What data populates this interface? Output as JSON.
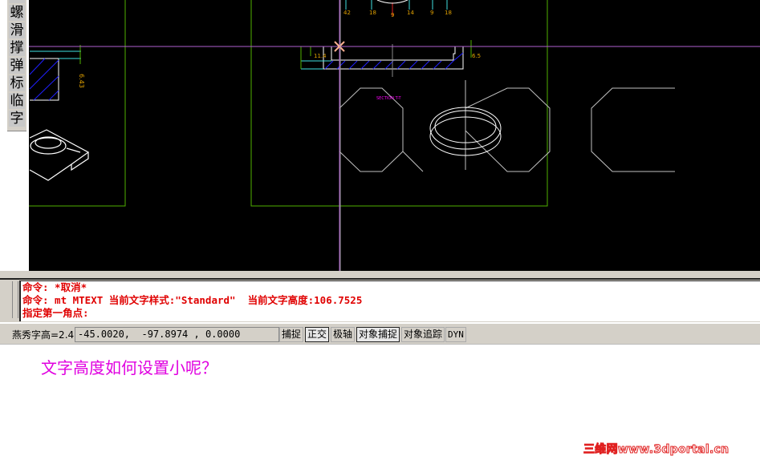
{
  "side_toolbar": {
    "items": [
      "螺",
      "滑",
      "撑",
      "弹",
      "标",
      "临",
      "字"
    ]
  },
  "drawing": {
    "dim_labels": [
      "6.43",
      "42",
      "18",
      "9",
      "14",
      "9",
      "18",
      "11.4",
      "6.5"
    ],
    "section_label": "SECTION T-T",
    "colors": {
      "background": "#000000",
      "crosshair": "#b060d0",
      "frame": "#50b000",
      "dimension": "#e0a000",
      "hatch": "#2020ff",
      "outline": "#ffffff",
      "guide": "#c0c0c0",
      "label": "#ff00ff"
    }
  },
  "command_line": {
    "lines": [
      "命令: *取消*",
      "命令: mt MTEXT 当前文字样式:\"Standard\"  当前文字高度:106.7525",
      "指定第一角点:"
    ]
  },
  "status_bar": {
    "label": "燕秀字高=2.4",
    "coordinates": "-45.0020,  -97.8974 , 0.0000",
    "buttons": [
      {
        "label": "捕捉",
        "on": false
      },
      {
        "label": "正交",
        "on": true
      },
      {
        "label": "极轴",
        "on": false
      },
      {
        "label": "对象捕捉",
        "on": true
      },
      {
        "label": "对象追踪",
        "on": false
      },
      {
        "label": "DYN",
        "on": false
      }
    ]
  },
  "question": "文字高度如何设置小呢？",
  "watermark": "三维网www.3dportal.cn"
}
